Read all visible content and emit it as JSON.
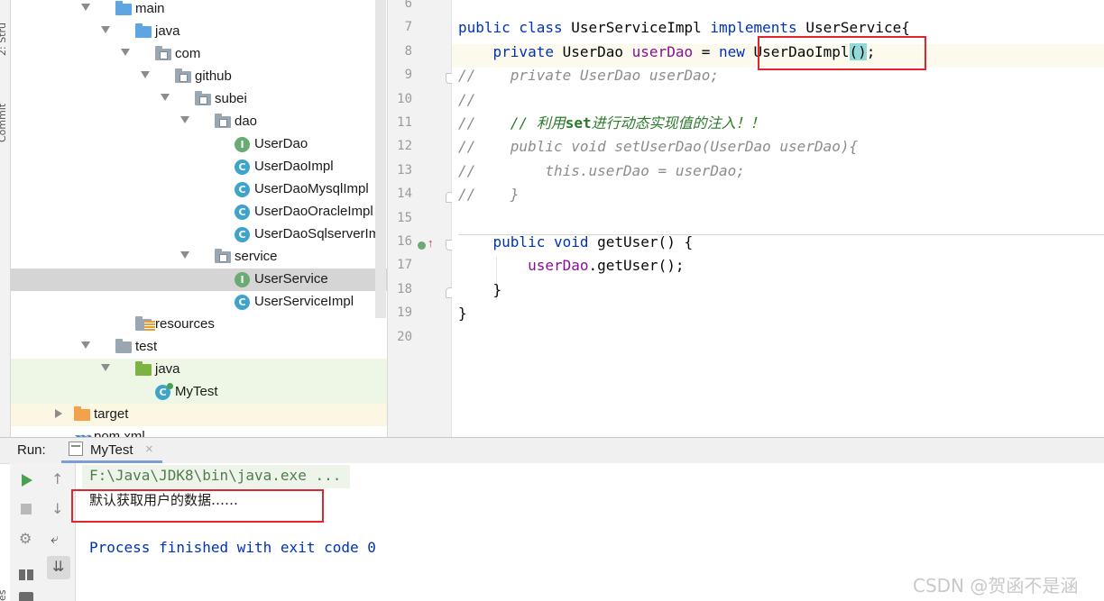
{
  "side_strip": {
    "top_label": "2: Stru",
    "bottom_label": "Commit",
    "bottom_corner": "es"
  },
  "tree": [
    {
      "label": "main",
      "kind": "folder-blue",
      "indent": 0,
      "arrow": "down"
    },
    {
      "label": "java",
      "kind": "folder-blue",
      "indent": 1,
      "arrow": "down"
    },
    {
      "label": "com",
      "kind": "package",
      "indent": 2,
      "arrow": "down"
    },
    {
      "label": "github",
      "kind": "package",
      "indent": 3,
      "arrow": "down"
    },
    {
      "label": "subei",
      "kind": "package",
      "indent": 4,
      "arrow": "down"
    },
    {
      "label": "dao",
      "kind": "package",
      "indent": 5,
      "arrow": "down"
    },
    {
      "label": "UserDao",
      "kind": "interface",
      "indent": 6,
      "icon_letter": "I"
    },
    {
      "label": "UserDaoImpl",
      "kind": "class",
      "indent": 6,
      "icon_letter": "C"
    },
    {
      "label": "UserDaoMysqlImpl",
      "kind": "class",
      "indent": 6,
      "icon_letter": "C"
    },
    {
      "label": "UserDaoOracleImpl",
      "kind": "class",
      "indent": 6,
      "icon_letter": "C"
    },
    {
      "label": "UserDaoSqlserverIm",
      "kind": "class",
      "indent": 6,
      "icon_letter": "C"
    },
    {
      "label": "service",
      "kind": "package",
      "indent": 5,
      "arrow": "down"
    },
    {
      "label": "UserService",
      "kind": "interface",
      "indent": 6,
      "icon_letter": "I",
      "selected": true
    },
    {
      "label": "UserServiceImpl",
      "kind": "class",
      "indent": 6,
      "icon_letter": "C"
    },
    {
      "label": "resources",
      "kind": "resources",
      "indent": 1
    },
    {
      "label": "test",
      "kind": "folder-grey",
      "indent": 0,
      "arrow": "down"
    },
    {
      "label": "java",
      "kind": "folder-green",
      "indent": 1,
      "arrow": "down",
      "tint": "green"
    },
    {
      "label": "MyTest",
      "kind": "test-class",
      "indent": 2,
      "icon_letter": "C",
      "tint": "green"
    },
    {
      "label": "target",
      "kind": "folder-orange",
      "indent": -1,
      "arrow": "right",
      "tint": "yellow"
    },
    {
      "label": "pom.xml",
      "kind": "maven",
      "indent": -1,
      "icon_letter": "m"
    }
  ],
  "editor": {
    "line_numbers": [
      "6",
      "7",
      "8",
      "9",
      "10",
      "11",
      "12",
      "13",
      "14",
      "15",
      "16",
      "17",
      "18",
      "19",
      "20"
    ],
    "lines": [
      [],
      [
        {
          "t": "public class ",
          "c": "kw"
        },
        {
          "t": "UserServiceImpl ",
          "c": ""
        },
        {
          "t": "implements ",
          "c": "kw"
        },
        {
          "t": "UserService{",
          "c": ""
        }
      ],
      [
        {
          "t": "    private ",
          "c": "kw"
        },
        {
          "t": "UserDao ",
          "c": ""
        },
        {
          "t": "userDao",
          "c": "fld"
        },
        {
          "t": " = ",
          "c": ""
        },
        {
          "t": "new ",
          "c": "kw"
        },
        {
          "t": "UserDaoImpl",
          "c": ""
        },
        {
          "t": "()",
          "c": "paren"
        },
        {
          "t": ";",
          "c": ""
        }
      ],
      [
        {
          "t": "//    private UserDao userDao;",
          "c": "cmt"
        }
      ],
      [
        {
          "t": "//",
          "c": "cmt"
        }
      ],
      [
        {
          "t": "//    ",
          "c": "cmt"
        },
        {
          "t": "// 利用",
          "c": "cmtg"
        },
        {
          "t": "set",
          "c": "cmtb"
        },
        {
          "t": "进行动态实现值的注入！！",
          "c": "cmtg"
        }
      ],
      [
        {
          "t": "//    public void setUserDao(UserDao userDao){",
          "c": "cmt"
        }
      ],
      [
        {
          "t": "//        this.userDao = userDao;",
          "c": "cmt"
        }
      ],
      [
        {
          "t": "//    }",
          "c": "cmt"
        }
      ],
      [],
      [
        {
          "t": "    public void ",
          "c": "kw"
        },
        {
          "t": "getUser() {",
          "c": ""
        }
      ],
      [
        {
          "t": "        ",
          "c": ""
        },
        {
          "t": "userDao",
          "c": "fld"
        },
        {
          "t": ".getUser();",
          "c": ""
        }
      ],
      [
        {
          "t": "    }",
          "c": ""
        }
      ],
      [
        {
          "t": "}",
          "c": ""
        }
      ],
      []
    ]
  },
  "run": {
    "label": "Run:",
    "tab_label": "MyTest",
    "tab_close": "×",
    "console_lines": [
      {
        "text": "F:\\Java\\JDK8\\bin\\java.exe ...",
        "style": "cmd"
      },
      {
        "text": "默认获取用户的数据……",
        "style": "out"
      },
      {
        "text": "",
        "style": "out"
      },
      {
        "text": "Process finished with exit code 0",
        "style": "exit"
      }
    ]
  },
  "watermark": "CSDN @贺函不是涵",
  "colors": {
    "selection": "#d5d5d5",
    "green_tint": "#eef7e6",
    "yellow_tint": "#fbf7e3",
    "highlight_box": "#e0252e",
    "paren_bg": "#93d9d9"
  }
}
